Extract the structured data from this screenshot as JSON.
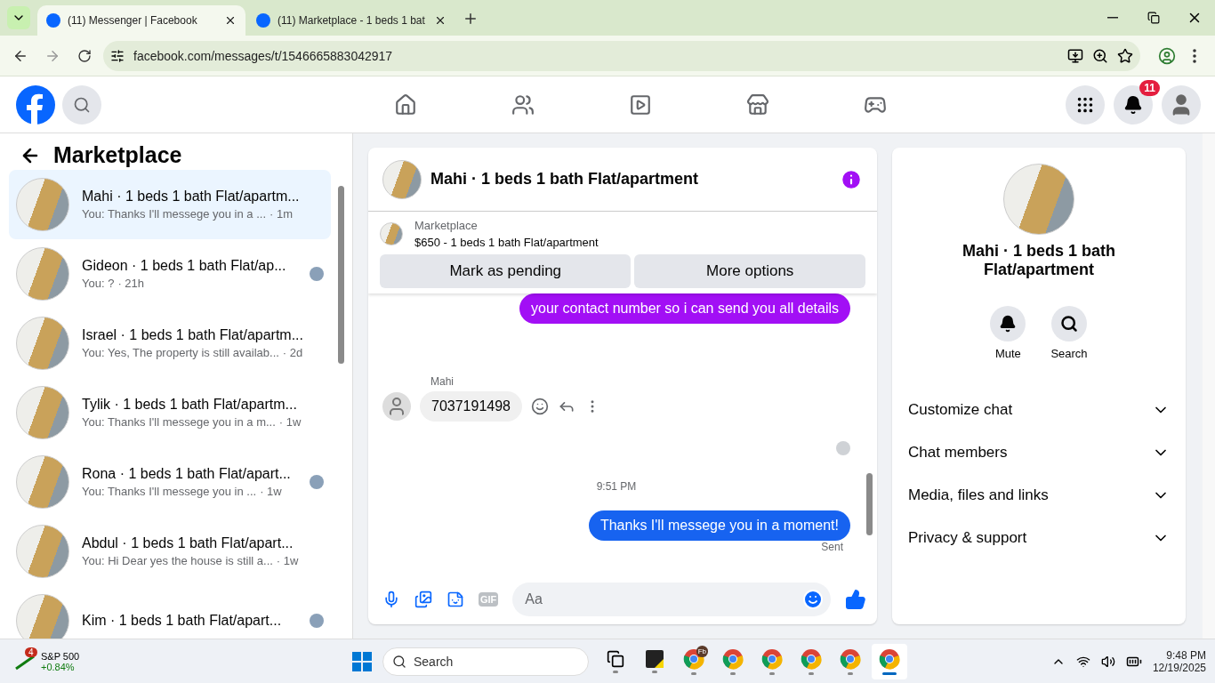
{
  "browser": {
    "tabs": [
      {
        "title": "(11) Messenger | Facebook",
        "selected": true
      },
      {
        "title": "(11) Marketplace - 1 beds 1 bat",
        "selected": false
      }
    ],
    "url": "facebook.com/messages/t/1546665883042917"
  },
  "header": {
    "notification_count": "11"
  },
  "sidebar": {
    "title": "Marketplace",
    "conversations": [
      {
        "name": "Mahi · 1 beds 1 bath Flat/apartm...",
        "preview": "You: Thanks I'll messege you in a ...",
        "time": "· 1m",
        "selected": true,
        "seen_avatar": false
      },
      {
        "name": "Gideon · 1 beds 1 bath Flat/ap...",
        "preview": "You: ?",
        "time": "· 21h",
        "selected": false,
        "seen_avatar": true
      },
      {
        "name": "Israel · 1 beds 1 bath Flat/apartm...",
        "preview": "You: Yes, The property is still availab...",
        "time": "· 2d",
        "selected": false,
        "seen_avatar": false
      },
      {
        "name": "Tylik · 1 beds 1 bath Flat/apartm...",
        "preview": "You: Thanks I'll messege you in a m...",
        "time": "· 1w",
        "selected": false,
        "seen_avatar": false
      },
      {
        "name": "Rona · 1 beds 1 bath Flat/apart...",
        "preview": "You: Thanks I'll messege you in ...",
        "time": "· 1w",
        "selected": false,
        "seen_avatar": true
      },
      {
        "name": "Abdul · 1 beds 1 bath Flat/apart...",
        "preview": "You: Hi Dear yes the house is still a...",
        "time": "· 1w",
        "selected": false,
        "seen_avatar": false
      },
      {
        "name": "Kim · 1 beds 1 bath Flat/apart...",
        "selected": false,
        "seen_avatar": true
      }
    ]
  },
  "chat": {
    "title": "Mahi · 1 beds 1 bath Flat/apartment",
    "listing": {
      "label": "Marketplace",
      "text": "$650 - 1 beds 1 bath Flat/apartment"
    },
    "actions": [
      "Mark as pending",
      "More options"
    ],
    "messages": [
      {
        "kind": "outgoing",
        "text": "your contact number so i can send you all details",
        "color": "#a20ff5"
      },
      {
        "kind": "incoming",
        "sender": "Mahi",
        "text": "7037191498"
      },
      {
        "kind": "seen"
      },
      {
        "kind": "time",
        "text": "9:51 PM"
      },
      {
        "kind": "outgoing",
        "text": "Thanks I'll messege you in a moment!",
        "color": "#1763f0",
        "status": "Sent"
      }
    ],
    "composer": {
      "gif_label": "GIF",
      "placeholder": "Aa"
    }
  },
  "details": {
    "title": "Mahi · 1 beds 1 bath Flat/apartment",
    "actions": [
      "Mute",
      "Search"
    ],
    "sections": [
      {
        "label": "Customize chat",
        "expanded": false
      },
      {
        "label": "Chat members",
        "expanded": false
      },
      {
        "label": "Media, files and links",
        "expanded": false
      },
      {
        "label": "Privacy & support",
        "expanded": false
      }
    ]
  },
  "taskbar": {
    "stock": {
      "badge": "4",
      "name": "S&P 500",
      "change": "+0.84%"
    },
    "search_placeholder": "Search",
    "apps": [
      {
        "kind": "taskview",
        "selected": false
      },
      {
        "kind": "notes",
        "selected": false
      },
      {
        "kind": "browser",
        "badge": "Fb",
        "selected": false
      },
      {
        "kind": "browser",
        "selected": false
      },
      {
        "kind": "browser",
        "selected": false
      },
      {
        "kind": "browser",
        "selected": false
      },
      {
        "kind": "browser",
        "selected": false
      },
      {
        "kind": "browser",
        "selected": true
      }
    ],
    "time": "9:48 PM",
    "date": "12/19/2025"
  }
}
